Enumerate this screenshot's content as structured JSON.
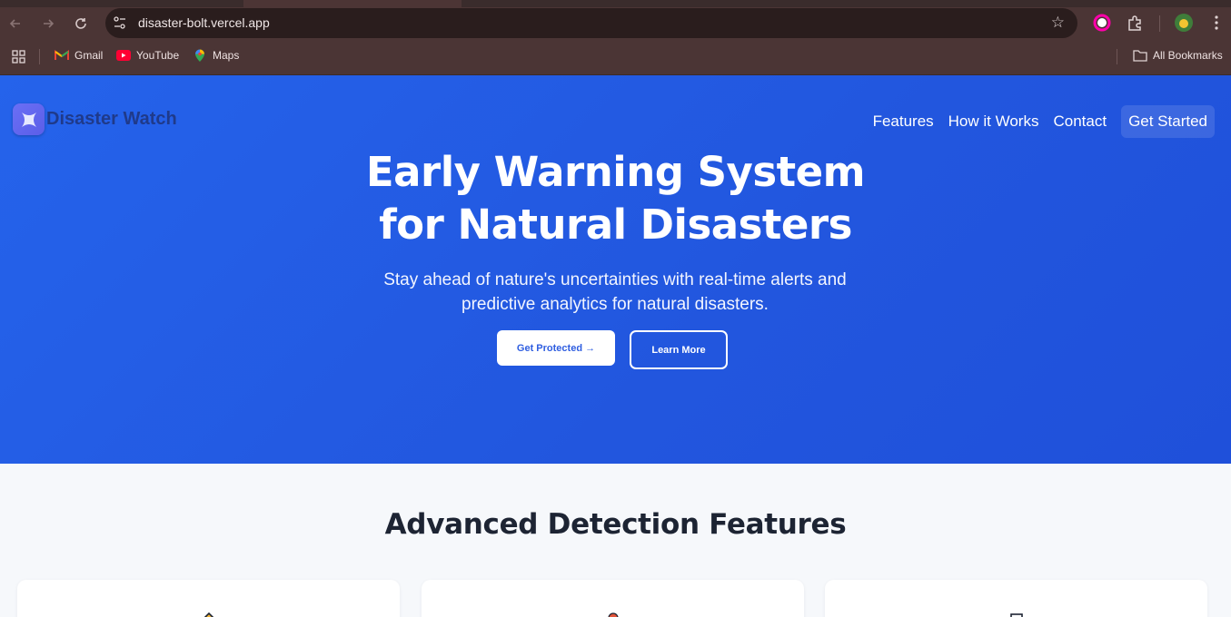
{
  "browser": {
    "url": "disaster-bolt.vercel.app",
    "bookmarks": [
      {
        "label": "Gmail",
        "icon": "gmail-icon"
      },
      {
        "label": "YouTube",
        "icon": "youtube-icon"
      },
      {
        "label": "Maps",
        "icon": "maps-icon"
      }
    ],
    "all_bookmarks": "All Bookmarks"
  },
  "site": {
    "brand": "Disaster Watch",
    "nav": [
      "Features",
      "How it Works",
      "Contact"
    ],
    "nav_cta": "Get Started",
    "headline_line1": "Early Warning System",
    "headline_line2": "for Natural Disasters",
    "subtitle_line1": "Stay ahead of nature's uncertainties with real-time alerts and",
    "subtitle_line2": "predictive analytics for natural disasters.",
    "primary_button": "Get Protected →",
    "secondary_button": "Learn More",
    "features_title": "Advanced Detection Features"
  },
  "colors": {
    "hero_blue": "#2563eb",
    "brand_text": "#1f3a8a",
    "chrome": "#4b3535"
  }
}
